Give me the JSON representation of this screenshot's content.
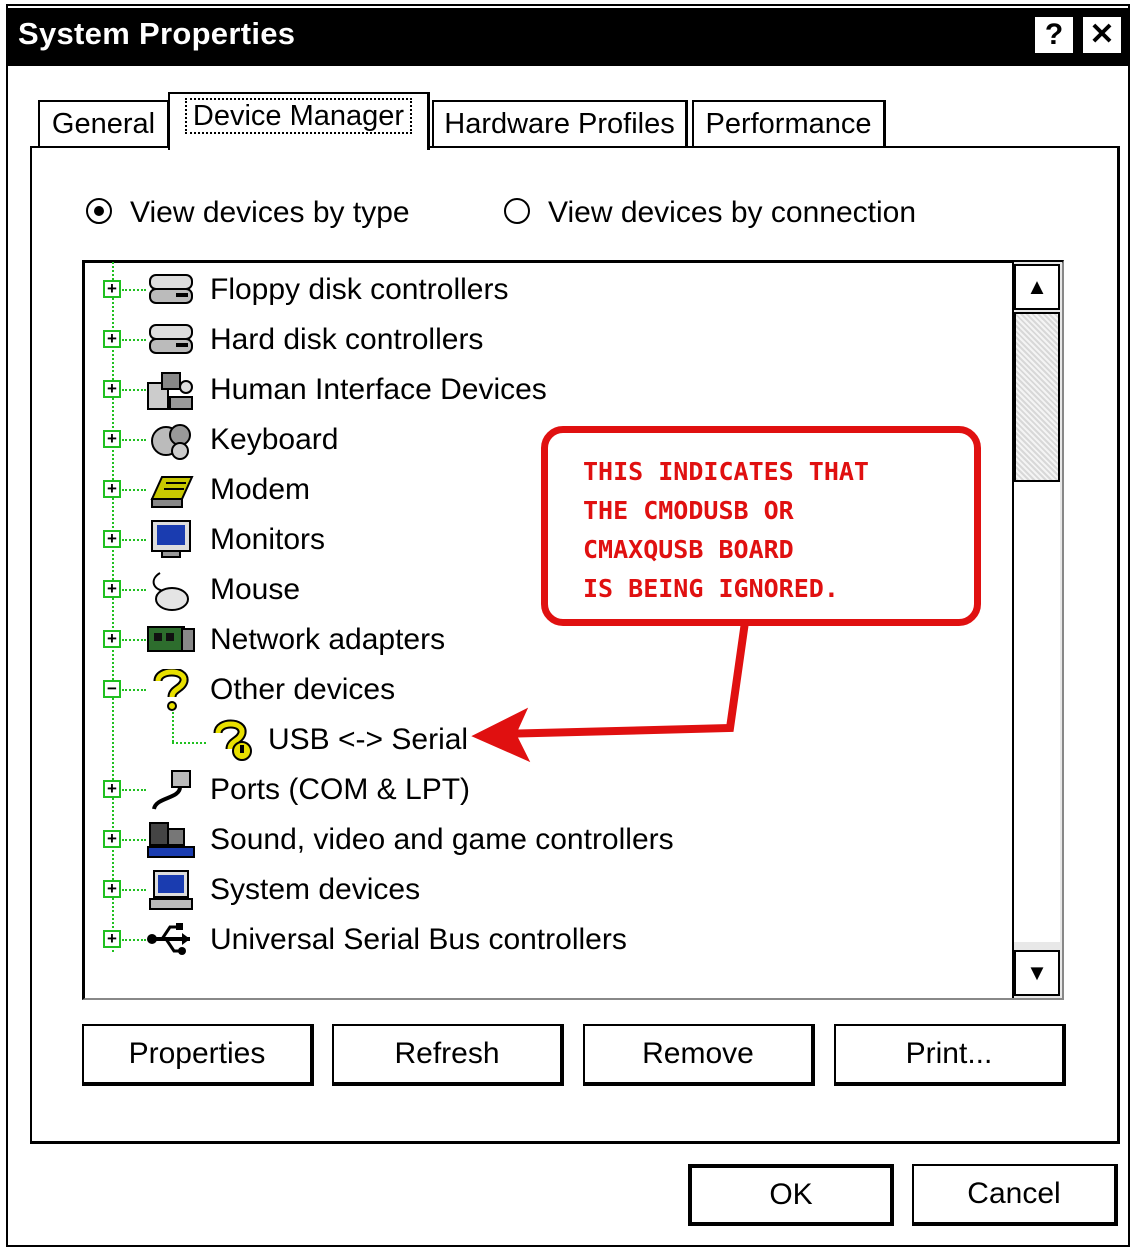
{
  "window": {
    "title": "System Properties",
    "help_label": "?",
    "close_label": "✕"
  },
  "tabs": [
    {
      "label": "General"
    },
    {
      "label": "Device Manager"
    },
    {
      "label": "Hardware Profiles"
    },
    {
      "label": "Performance"
    }
  ],
  "view_options": {
    "by_type": "View devices by type",
    "by_connection": "View devices by connection",
    "selected": "by_type"
  },
  "tree": [
    {
      "label": "Floppy disk controllers",
      "expander": "+",
      "icon": "disk-controller-icon"
    },
    {
      "label": "Hard disk controllers",
      "expander": "+",
      "icon": "disk-controller-icon"
    },
    {
      "label": "Human Interface Devices",
      "expander": "+",
      "icon": "hid-icon"
    },
    {
      "label": "Keyboard",
      "expander": "+",
      "icon": "keyboard-icon"
    },
    {
      "label": "Modem",
      "expander": "+",
      "icon": "modem-icon"
    },
    {
      "label": "Monitors",
      "expander": "+",
      "icon": "monitor-icon"
    },
    {
      "label": "Mouse",
      "expander": "+",
      "icon": "mouse-icon"
    },
    {
      "label": "Network adapters",
      "expander": "+",
      "icon": "network-adapter-icon"
    },
    {
      "label": "Other devices",
      "expander": "−",
      "icon": "question-mark-icon"
    },
    {
      "label": "USB <-> Serial",
      "expander": "",
      "icon": "unknown-device-icon"
    },
    {
      "label": "Ports (COM & LPT)",
      "expander": "+",
      "icon": "port-icon"
    },
    {
      "label": "Sound, video and game controllers",
      "expander": "+",
      "icon": "sound-icon"
    },
    {
      "label": "System devices",
      "expander": "+",
      "icon": "system-device-icon"
    },
    {
      "label": "Universal Serial Bus controllers",
      "expander": "+",
      "icon": "usb-icon"
    }
  ],
  "buttons": {
    "properties": "Properties",
    "refresh": "Refresh",
    "remove": "Remove",
    "print": "Print...",
    "ok": "OK",
    "cancel": "Cancel"
  },
  "annotation": {
    "text": "THIS INDICATES THAT\nTHE CMODUSB OR\nCMAXQUSB BOARD\nIS BEING IGNORED.",
    "color": "#e01010"
  },
  "scrollbar": {
    "up_label": "▲",
    "down_label": "▼"
  }
}
